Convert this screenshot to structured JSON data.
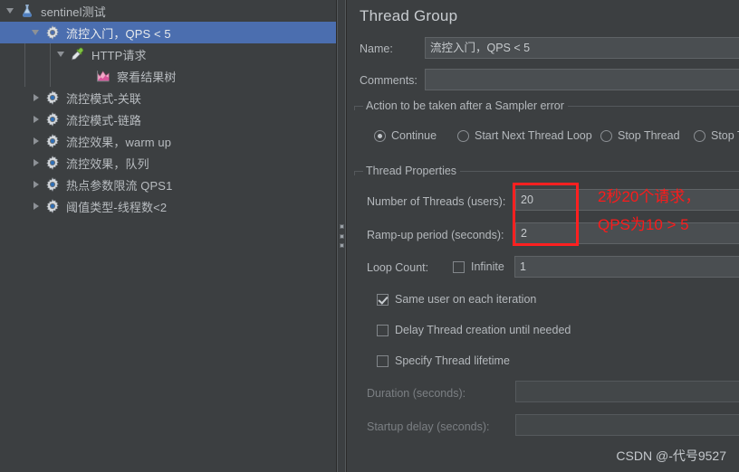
{
  "tree": {
    "items": [
      {
        "label": "sentinel测试",
        "icon": "flask-icon",
        "depth": 0,
        "twisty": "expanded",
        "selected": false
      },
      {
        "label": "流控入门，QPS < 5",
        "icon": "gear-icon",
        "depth": 1,
        "twisty": "expanded",
        "selected": true
      },
      {
        "label": "HTTP请求",
        "icon": "pipette-icon",
        "depth": 2,
        "twisty": "expanded",
        "selected": false
      },
      {
        "label": "察看结果树",
        "icon": "chart-icon",
        "depth": 3,
        "twisty": "none",
        "selected": false
      },
      {
        "label": "流控模式-关联",
        "icon": "gear-icon",
        "depth": 1,
        "twisty": "collapsed",
        "selected": false
      },
      {
        "label": "流控模式-链路",
        "icon": "gear-icon",
        "depth": 1,
        "twisty": "collapsed",
        "selected": false
      },
      {
        "label": "流控效果，warm up",
        "icon": "gear-icon",
        "depth": 1,
        "twisty": "collapsed",
        "selected": false
      },
      {
        "label": "流控效果，队列",
        "icon": "gear-icon",
        "depth": 1,
        "twisty": "collapsed",
        "selected": false
      },
      {
        "label": "热点参数限流 QPS1",
        "icon": "gear-icon",
        "depth": 1,
        "twisty": "collapsed",
        "selected": false
      },
      {
        "label": "阈值类型-线程数<2",
        "icon": "gear-icon",
        "depth": 1,
        "twisty": "collapsed",
        "selected": false
      }
    ]
  },
  "panel": {
    "title": "Thread Group",
    "name_label": "Name:",
    "name_value": "流控入门，QPS < 5",
    "comments_label": "Comments:",
    "comments_value": "",
    "sampler_error_group": "Action to be taken after a Sampler error",
    "sampler_error_options": [
      {
        "label": "Continue",
        "checked": true
      },
      {
        "label": "Start Next Thread Loop",
        "checked": false
      },
      {
        "label": "Stop Thread",
        "checked": false
      },
      {
        "label": "Stop T",
        "checked": false
      }
    ],
    "thread_properties_group": "Thread Properties",
    "num_threads_label": "Number of Threads (users):",
    "num_threads_value": "20",
    "ramp_up_label": "Ramp-up period (seconds):",
    "ramp_up_value": "2",
    "loop_count_label": "Loop Count:",
    "infinite_label": "Infinite",
    "infinite_checked": false,
    "loop_count_value": "1",
    "same_user_label": "Same user on each iteration",
    "same_user_checked": true,
    "delay_thread_label": "Delay Thread creation until needed",
    "delay_thread_checked": false,
    "specify_lifetime_label": "Specify Thread lifetime",
    "specify_lifetime_checked": false,
    "duration_label": "Duration (seconds):",
    "duration_value": "",
    "startup_delay_label": "Startup delay (seconds):",
    "startup_delay_value": ""
  },
  "annotation": {
    "line1": "2秒20个请求，",
    "line2": "QPS为10 > 5",
    "color": "#fb1b1b"
  },
  "watermark": "CSDN @-代号9527",
  "colors": {
    "background": "#3c3f41",
    "selection": "#4b6eaf",
    "text": "#b4b8bc",
    "field_bg": "#4a4e51",
    "annotation_red": "#fb1b1b"
  }
}
